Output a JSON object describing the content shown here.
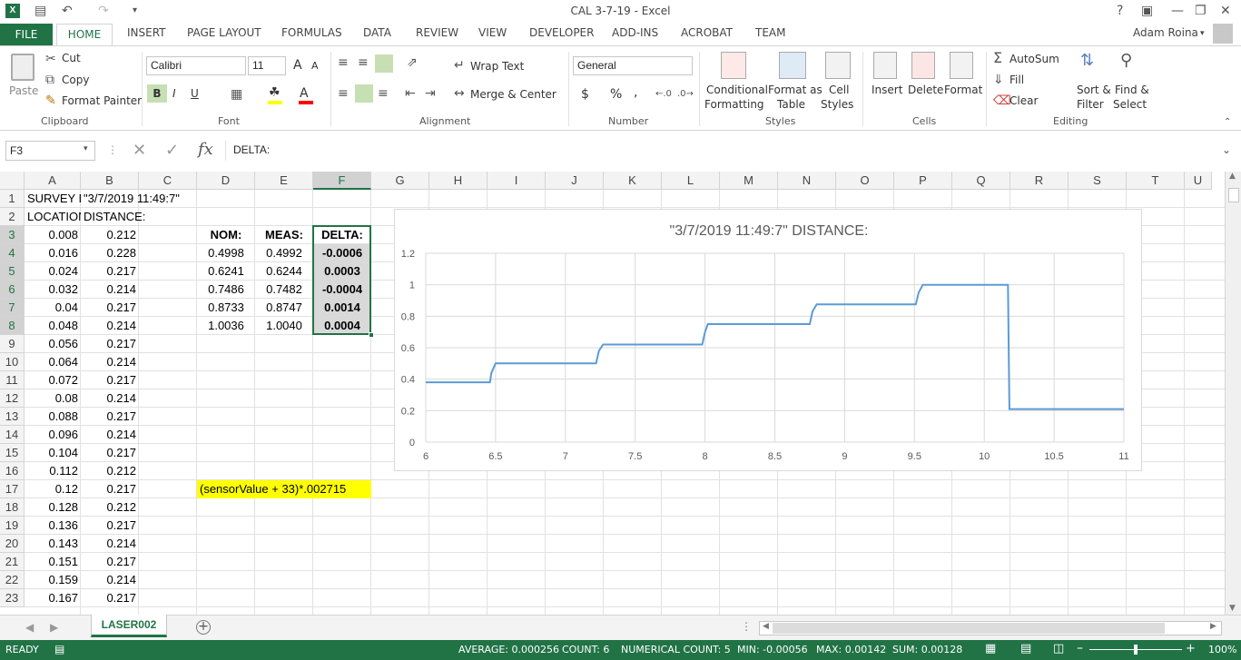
{
  "window": {
    "title": "CAL 3-7-19 - Excel",
    "user": "Adam Roina"
  },
  "ribbon_tabs": [
    "FILE",
    "HOME",
    "INSERT",
    "PAGE LAYOUT",
    "FORMULAS",
    "DATA",
    "REVIEW",
    "VIEW",
    "DEVELOPER",
    "ADD-INS",
    "ACROBAT",
    "TEAM"
  ],
  "clipboard": {
    "paste": "Paste",
    "cut": "Cut",
    "copy": "Copy",
    "format_painter": "Format Painter",
    "label": "Clipboard"
  },
  "font": {
    "name": "Calibri",
    "size": "11",
    "bold": "B",
    "italic": "I",
    "underline": "U",
    "label": "Font"
  },
  "alignment": {
    "wrap": "Wrap Text",
    "merge": "Merge & Center",
    "label": "Alignment"
  },
  "number": {
    "format": "General",
    "currency": "$",
    "percent": "%",
    "comma": ",",
    "label": "Number"
  },
  "styles": {
    "cond1": "Conditional",
    "cond2": "Formatting",
    "fat1": "Format as",
    "fat2": "Table",
    "cs1": "Cell",
    "cs2": "Styles",
    "label": "Styles"
  },
  "cells": {
    "insert": "Insert",
    "delete": "Delete",
    "format": "Format",
    "label": "Cells"
  },
  "editing": {
    "autosum": "AutoSum",
    "fill": "Fill",
    "clear": "Clear",
    "sf1": "Sort &",
    "sf2": "Filter",
    "fs1": "Find &",
    "fs2": "Select",
    "label": "Editing"
  },
  "formula_bar": {
    "name_box": "F3",
    "fx": "fx",
    "content": "DELTA:"
  },
  "columns": [
    "A",
    "B",
    "C",
    "D",
    "E",
    "F",
    "G",
    "H",
    "I",
    "J",
    "K",
    "L",
    "M",
    "N",
    "O",
    "P",
    "Q",
    "R",
    "S",
    "T",
    "U"
  ],
  "rows": [
    "1",
    "2",
    "3",
    "4",
    "5",
    "6",
    "7",
    "8",
    "9",
    "10",
    "11",
    "12",
    "13",
    "14",
    "15",
    "16",
    "17",
    "18",
    "19",
    "20",
    "21",
    "22",
    "23"
  ],
  "sheet": {
    "A1": "SURVEY D/",
    "B1": "\"3/7/2019  11:49:7\"",
    "A2": "LOCATION",
    "B2": "DISTANCE:",
    "colA": [
      "0.008",
      "0.016",
      "0.024",
      "0.032",
      "0.04",
      "0.048",
      "0.056",
      "0.064",
      "0.072",
      "0.08",
      "0.088",
      "0.096",
      "0.104",
      "0.112",
      "0.12",
      "0.128",
      "0.136",
      "0.143",
      "0.151",
      "0.159",
      "0.167"
    ],
    "colB": [
      "0.212",
      "0.228",
      "0.217",
      "0.214",
      "0.217",
      "0.214",
      "0.217",
      "0.214",
      "0.217",
      "0.214",
      "0.217",
      "0.214",
      "0.217",
      "0.212",
      "0.217",
      "0.212",
      "0.217",
      "0.214",
      "0.217",
      "0.214",
      "0.217"
    ],
    "hdrD": "NOM:",
    "hdrE": "MEAS:",
    "hdrF": "DELTA:",
    "nom": [
      "0.4998",
      "0.6241",
      "0.7486",
      "0.8733",
      "1.0036"
    ],
    "meas": [
      "0.4992",
      "0.6244",
      "0.7482",
      "0.8747",
      "1.0040"
    ],
    "delta": [
      "-0.0006",
      "0.0003",
      "-0.0004",
      "0.0014",
      "0.0004"
    ],
    "note": "(sensorValue + 33)*.002715",
    "highlight": "#ffff00"
  },
  "chart_data": {
    "type": "line",
    "title": "\"3/7/2019  11:49:7\" DISTANCE:",
    "xlim": [
      6,
      11
    ],
    "ylim": [
      0,
      1.2
    ],
    "xticks": [
      "6",
      "6.5",
      "7",
      "7.5",
      "8",
      "8.5",
      "9",
      "9.5",
      "10",
      "10.5",
      "11"
    ],
    "yticks": [
      "0",
      "0.2",
      "0.4",
      "0.6",
      "0.8",
      "1",
      "1.2"
    ],
    "line_color": "#5b9bd5",
    "series": [
      {
        "x": [
          6,
          6.46,
          6.47,
          6.5,
          7.22,
          7.24,
          7.27,
          7.98,
          8.0,
          8.02,
          8.75,
          8.77,
          8.8,
          9.51,
          9.53,
          9.56,
          10.17,
          10.18,
          11.0
        ],
        "y": [
          0.38,
          0.38,
          0.44,
          0.5,
          0.5,
          0.58,
          0.62,
          0.62,
          0.7,
          0.75,
          0.75,
          0.83,
          0.875,
          0.875,
          0.95,
          1.0,
          1.0,
          0.21,
          0.21
        ]
      }
    ]
  },
  "sheet_tab": "LASER002",
  "status": {
    "ready": "READY",
    "average": "AVERAGE: 0.000256",
    "count": "COUNT: 6",
    "numcount": "NUMERICAL COUNT: 5",
    "min": "MIN: -0.00056",
    "max": "MAX: 0.00142",
    "sum": "SUM: 0.00128",
    "zoom": "100%"
  },
  "colors": {
    "accent": "#217346",
    "selection_fill": "#d9d9d9"
  }
}
